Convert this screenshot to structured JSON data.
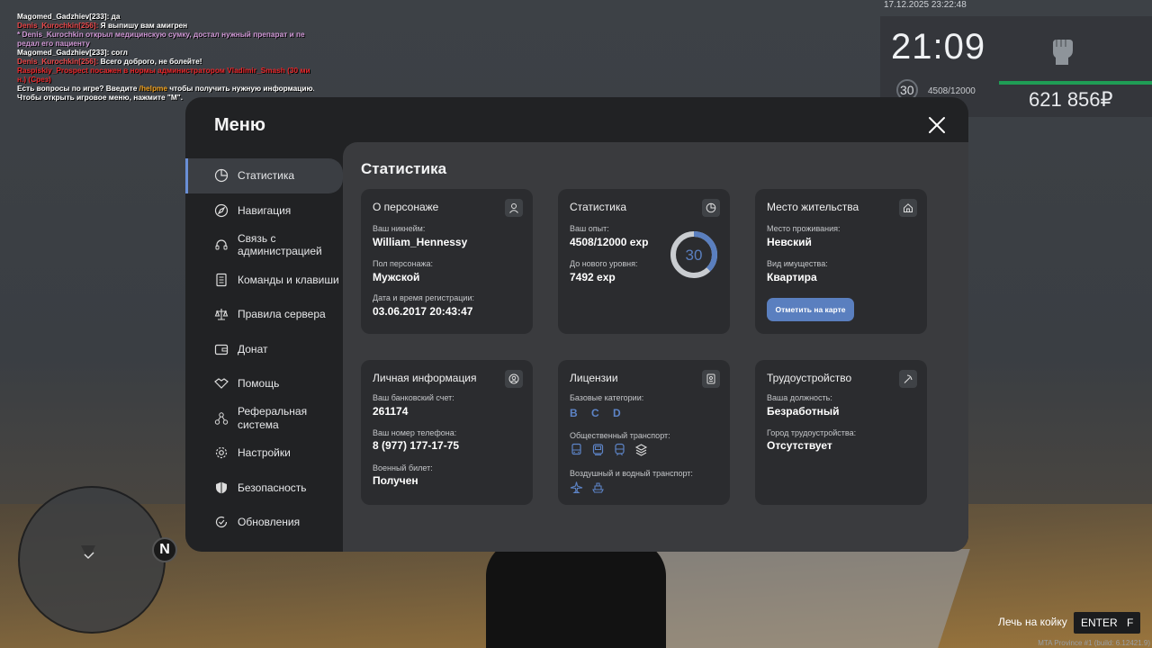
{
  "chat": [
    {
      "name": "Magomed_Gadzhiev[233]:",
      "name_color": "#ffffff",
      "text": " да",
      "text_color": "#ffffff"
    },
    {
      "name": "Denis_Kurochkin[256]:",
      "name_color": "#e8474a",
      "text": " Я выпишу вам амигрен",
      "text_color": "#ffffff"
    },
    {
      "name": "* Denis_Kurochkin открыл медицинскую сумку, достал нужный препарат и пе редал его пациенту",
      "name_color": "#d29ad8",
      "text": "",
      "text_color": "#d29ad8"
    },
    {
      "name": "Magomed_Gadzhiev[233]:",
      "name_color": "#ffffff",
      "text": " согл",
      "text_color": "#ffffff"
    },
    {
      "name": "Denis_Kurochkin[256]:",
      "name_color": "#e8474a",
      "text": " Всего доброго, не болейте!",
      "text_color": "#ffffff"
    },
    {
      "name": "Raspiskiy_Prospect посажен в нормы администратором Vladimir_Smash (30 ми н.) (Срез)",
      "name_color": "#e8262a",
      "text": "",
      "text_color": "#e8262a"
    },
    {
      "name": "Есть вопросы по игре? Введите ",
      "name_color": "#ffffff",
      "text": "/helpme",
      "text_color": "#f5a623",
      "tail": " чтобы получить нужную информацию."
    },
    {
      "name": "Чтобы открыть игровое меню, нажмите \"M\".",
      "name_color": "#ffffff",
      "text": "",
      "text_color": "#ffffff"
    }
  ],
  "hud": {
    "datetime": "17.12.2025 23:22:48",
    "time": "21:09",
    "level": "30",
    "exp": "4508/12000",
    "money": "621 856₽",
    "health_color": "#1f9d55"
  },
  "minimap": {
    "north_label": "N"
  },
  "hints": {
    "action": "Лечь на койку",
    "key1": "ENTER",
    "key2": "F"
  },
  "build": "MTA Province #1 (build: 6.12421.9)",
  "menu": {
    "title": "Меню",
    "accent": "#6a8fd6",
    "sidebar": [
      {
        "label": "Статистика",
        "icon": "pie-chart-icon",
        "active": true
      },
      {
        "label": "Навигация",
        "icon": "compass-icon",
        "active": false
      },
      {
        "label": "Связь с администрацией",
        "icon": "headset-icon",
        "active": false
      },
      {
        "label": "Команды и клавиши",
        "icon": "document-icon",
        "active": false
      },
      {
        "label": "Правила сервера",
        "icon": "scales-icon",
        "active": false
      },
      {
        "label": "Донат",
        "icon": "wallet-icon",
        "active": false
      },
      {
        "label": "Помощь",
        "icon": "handshake-icon",
        "active": false
      },
      {
        "label": "Реферальная система",
        "icon": "network-icon",
        "active": false
      },
      {
        "label": "Настройки",
        "icon": "gear-icon",
        "active": false
      },
      {
        "label": "Безопасность",
        "icon": "shield-icon",
        "active": false
      },
      {
        "label": "Обновления",
        "icon": "refresh-check-icon",
        "active": false
      }
    ],
    "content_title": "Статистика",
    "cards": {
      "character": {
        "title": "О персонаже",
        "icon": "user-icon",
        "nick_label": "Ваш никнейм:",
        "nick": "William_Hennessy",
        "sex_label": "Пол персонажа:",
        "sex": "Мужской",
        "reg_label": "Дата и время регистрации:",
        "reg": "03.06.2017 20:43:47"
      },
      "stats": {
        "title": "Статистика",
        "icon": "pie-chart-icon",
        "exp_label": "Ваш опыт:",
        "exp": "4508/12000 exp",
        "next_label": "До нового уровня:",
        "next": "7492 exp",
        "level": "30",
        "progress": 0.3757,
        "ring_color": "#5a7fbf",
        "ring_track": "#c9ccd0"
      },
      "residence": {
        "title": "Место жительства",
        "icon": "home-icon",
        "place_label": "Место проживания:",
        "place": "Невский",
        "type_label": "Вид имущества:",
        "type": "Квартира",
        "button": "Отметить на карте"
      },
      "personal": {
        "title": "Личная информация",
        "icon": "user-circle-icon",
        "bank_label": "Ваш банковский счет:",
        "bank": "261174",
        "phone_label": "Ваш номер телефона:",
        "phone": "8 (977) 177-17-75",
        "military_label": "Военный билет:",
        "military": "Получен"
      },
      "licenses": {
        "title": "Лицензии",
        "icon": "id-card-icon",
        "base_label": "Базовые категории:",
        "base": "B C D",
        "public_label": "Общественный транспорт:",
        "public_icons": [
          "bus-icon",
          "tram-icon",
          "train-icon",
          "metro-icon"
        ],
        "air_label": "Воздушный и водный транспорт:",
        "air_icons": [
          "plane-icon",
          "boat-icon"
        ]
      },
      "job": {
        "title": "Трудоустройство",
        "icon": "pickaxe-icon",
        "pos_label": "Ваша должность:",
        "pos": "Безработный",
        "city_label": "Город трудоустройства:",
        "city": "Отсутствует"
      }
    }
  }
}
